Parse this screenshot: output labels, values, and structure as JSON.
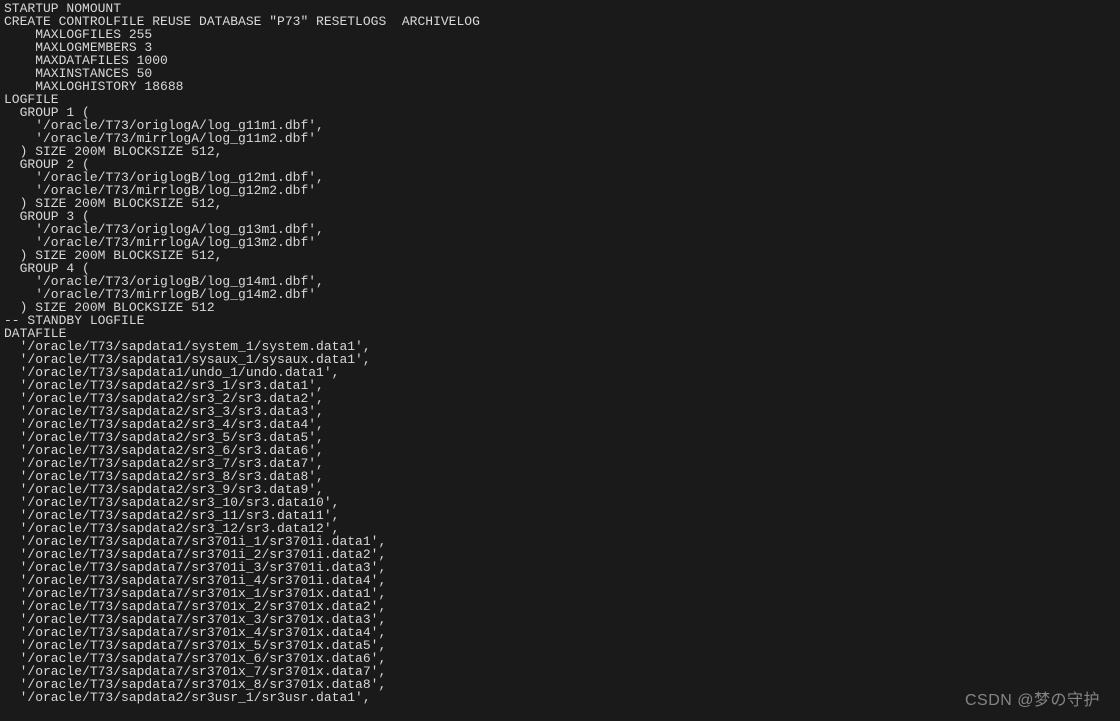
{
  "terminal": {
    "lines": [
      "STARTUP NOMOUNT",
      "CREATE CONTROLFILE REUSE DATABASE \"P73\" RESETLOGS  ARCHIVELOG",
      "    MAXLOGFILES 255",
      "    MAXLOGMEMBERS 3",
      "    MAXDATAFILES 1000",
      "    MAXINSTANCES 50",
      "    MAXLOGHISTORY 18688",
      "LOGFILE",
      "  GROUP 1 (",
      "    '/oracle/T73/origlogA/log_g11m1.dbf',",
      "    '/oracle/T73/mirrlogA/log_g11m2.dbf'",
      "  ) SIZE 200M BLOCKSIZE 512,",
      "  GROUP 2 (",
      "    '/oracle/T73/origlogB/log_g12m1.dbf',",
      "    '/oracle/T73/mirrlogB/log_g12m2.dbf'",
      "  ) SIZE 200M BLOCKSIZE 512,",
      "  GROUP 3 (",
      "    '/oracle/T73/origlogA/log_g13m1.dbf',",
      "    '/oracle/T73/mirrlogA/log_g13m2.dbf'",
      "  ) SIZE 200M BLOCKSIZE 512,",
      "  GROUP 4 (",
      "    '/oracle/T73/origlogB/log_g14m1.dbf',",
      "    '/oracle/T73/mirrlogB/log_g14m2.dbf'",
      "  ) SIZE 200M BLOCKSIZE 512",
      "-- STANDBY LOGFILE",
      "DATAFILE",
      "  '/oracle/T73/sapdata1/system_1/system.data1',",
      "  '/oracle/T73/sapdata1/sysaux_1/sysaux.data1',",
      "  '/oracle/T73/sapdata1/undo_1/undo.data1',",
      "  '/oracle/T73/sapdata2/sr3_1/sr3.data1',",
      "  '/oracle/T73/sapdata2/sr3_2/sr3.data2',",
      "  '/oracle/T73/sapdata2/sr3_3/sr3.data3',",
      "  '/oracle/T73/sapdata2/sr3_4/sr3.data4',",
      "  '/oracle/T73/sapdata2/sr3_5/sr3.data5',",
      "  '/oracle/T73/sapdata2/sr3_6/sr3.data6',",
      "  '/oracle/T73/sapdata2/sr3_7/sr3.data7',",
      "  '/oracle/T73/sapdata2/sr3_8/sr3.data8',",
      "  '/oracle/T73/sapdata2/sr3_9/sr3.data9',",
      "  '/oracle/T73/sapdata2/sr3_10/sr3.data10',",
      "  '/oracle/T73/sapdata2/sr3_11/sr3.data11',",
      "  '/oracle/T73/sapdata2/sr3_12/sr3.data12',",
      "  '/oracle/T73/sapdata7/sr3701i_1/sr3701i.data1',",
      "  '/oracle/T73/sapdata7/sr3701i_2/sr3701i.data2',",
      "  '/oracle/T73/sapdata7/sr3701i_3/sr3701i.data3',",
      "  '/oracle/T73/sapdata7/sr3701i_4/sr3701i.data4',",
      "  '/oracle/T73/sapdata7/sr3701x_1/sr3701x.data1',",
      "  '/oracle/T73/sapdata7/sr3701x_2/sr3701x.data2',",
      "  '/oracle/T73/sapdata7/sr3701x_3/sr3701x.data3',",
      "  '/oracle/T73/sapdata7/sr3701x_4/sr3701x.data4',",
      "  '/oracle/T73/sapdata7/sr3701x_5/sr3701x.data5',",
      "  '/oracle/T73/sapdata7/sr3701x_6/sr3701x.data6',",
      "  '/oracle/T73/sapdata7/sr3701x_7/sr3701x.data7',",
      "  '/oracle/T73/sapdata7/sr3701x_8/sr3701x.data8',",
      "  '/oracle/T73/sapdata2/sr3usr_1/sr3usr.data1',"
    ]
  },
  "watermark": "CSDN @梦の守护"
}
